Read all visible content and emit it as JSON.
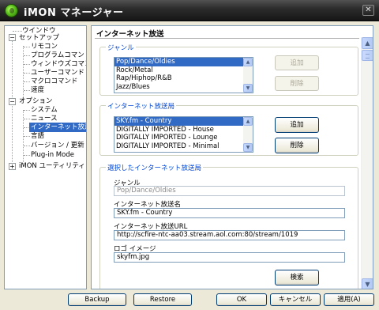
{
  "window": {
    "title": "iMON マネージャー"
  },
  "tree": {
    "items": [
      {
        "label": "ウインドウ"
      },
      {
        "label": "セットアップ"
      },
      {
        "label": "リモコン"
      },
      {
        "label": "プログラムコマンド"
      },
      {
        "label": "ウィンドウズコマンド"
      },
      {
        "label": "ユーザーコマンド"
      },
      {
        "label": "マクロコマンド"
      },
      {
        "label": "速度"
      },
      {
        "label": "オプション"
      },
      {
        "label": "システム"
      },
      {
        "label": "ニュース"
      },
      {
        "label": "インターネット放送"
      },
      {
        "label": "言語"
      },
      {
        "label": "バージョン / 更新"
      },
      {
        "label": "Plug-in Mode"
      },
      {
        "label": "iMON ユーティリティ"
      }
    ],
    "expanders": {
      "setup": "−",
      "options": "−",
      "utility": "+"
    }
  },
  "panel": {
    "title": "インターネット放送",
    "genre_group": {
      "label": "ジャンル",
      "items": [
        "Pop/Dance/Oldies",
        "Rock/Metal",
        "Rap/Hiphop/R&B",
        "Jazz/Blues"
      ],
      "add_button": "追加",
      "delete_button": "削除"
    },
    "station_group": {
      "label": "インターネット放送局",
      "items": [
        "SKY.fm - Country",
        "DIGITALLY IMPORTED - House",
        "DIGITALLY IMPORTED - Lounge",
        "DIGITALLY IMPORTED - Minimal"
      ],
      "add_button": "追加",
      "delete_button": "削除"
    },
    "selected_group": {
      "label": "選択したインターネット放送局",
      "genre_label": "ジャンル",
      "genre_value": "Pop/Dance/Oldies",
      "name_label": "インターネット放送名",
      "name_value": "SKY.fm - Country",
      "url_label": "インターネット放送URL",
      "url_value": "http://scfire-ntc-aa03.stream.aol.com:80/stream/1019",
      "logo_label": "ロゴ イメージ",
      "logo_value": "skyfm.jpg",
      "search_button": "検索"
    }
  },
  "footer": {
    "backup": "Backup",
    "restore": "Restore",
    "ok": "OK",
    "cancel": "キャンセル",
    "apply": "適用(A)"
  },
  "icons": {
    "close": "✕",
    "scroll_up": "▲",
    "scroll_down": "▼"
  }
}
